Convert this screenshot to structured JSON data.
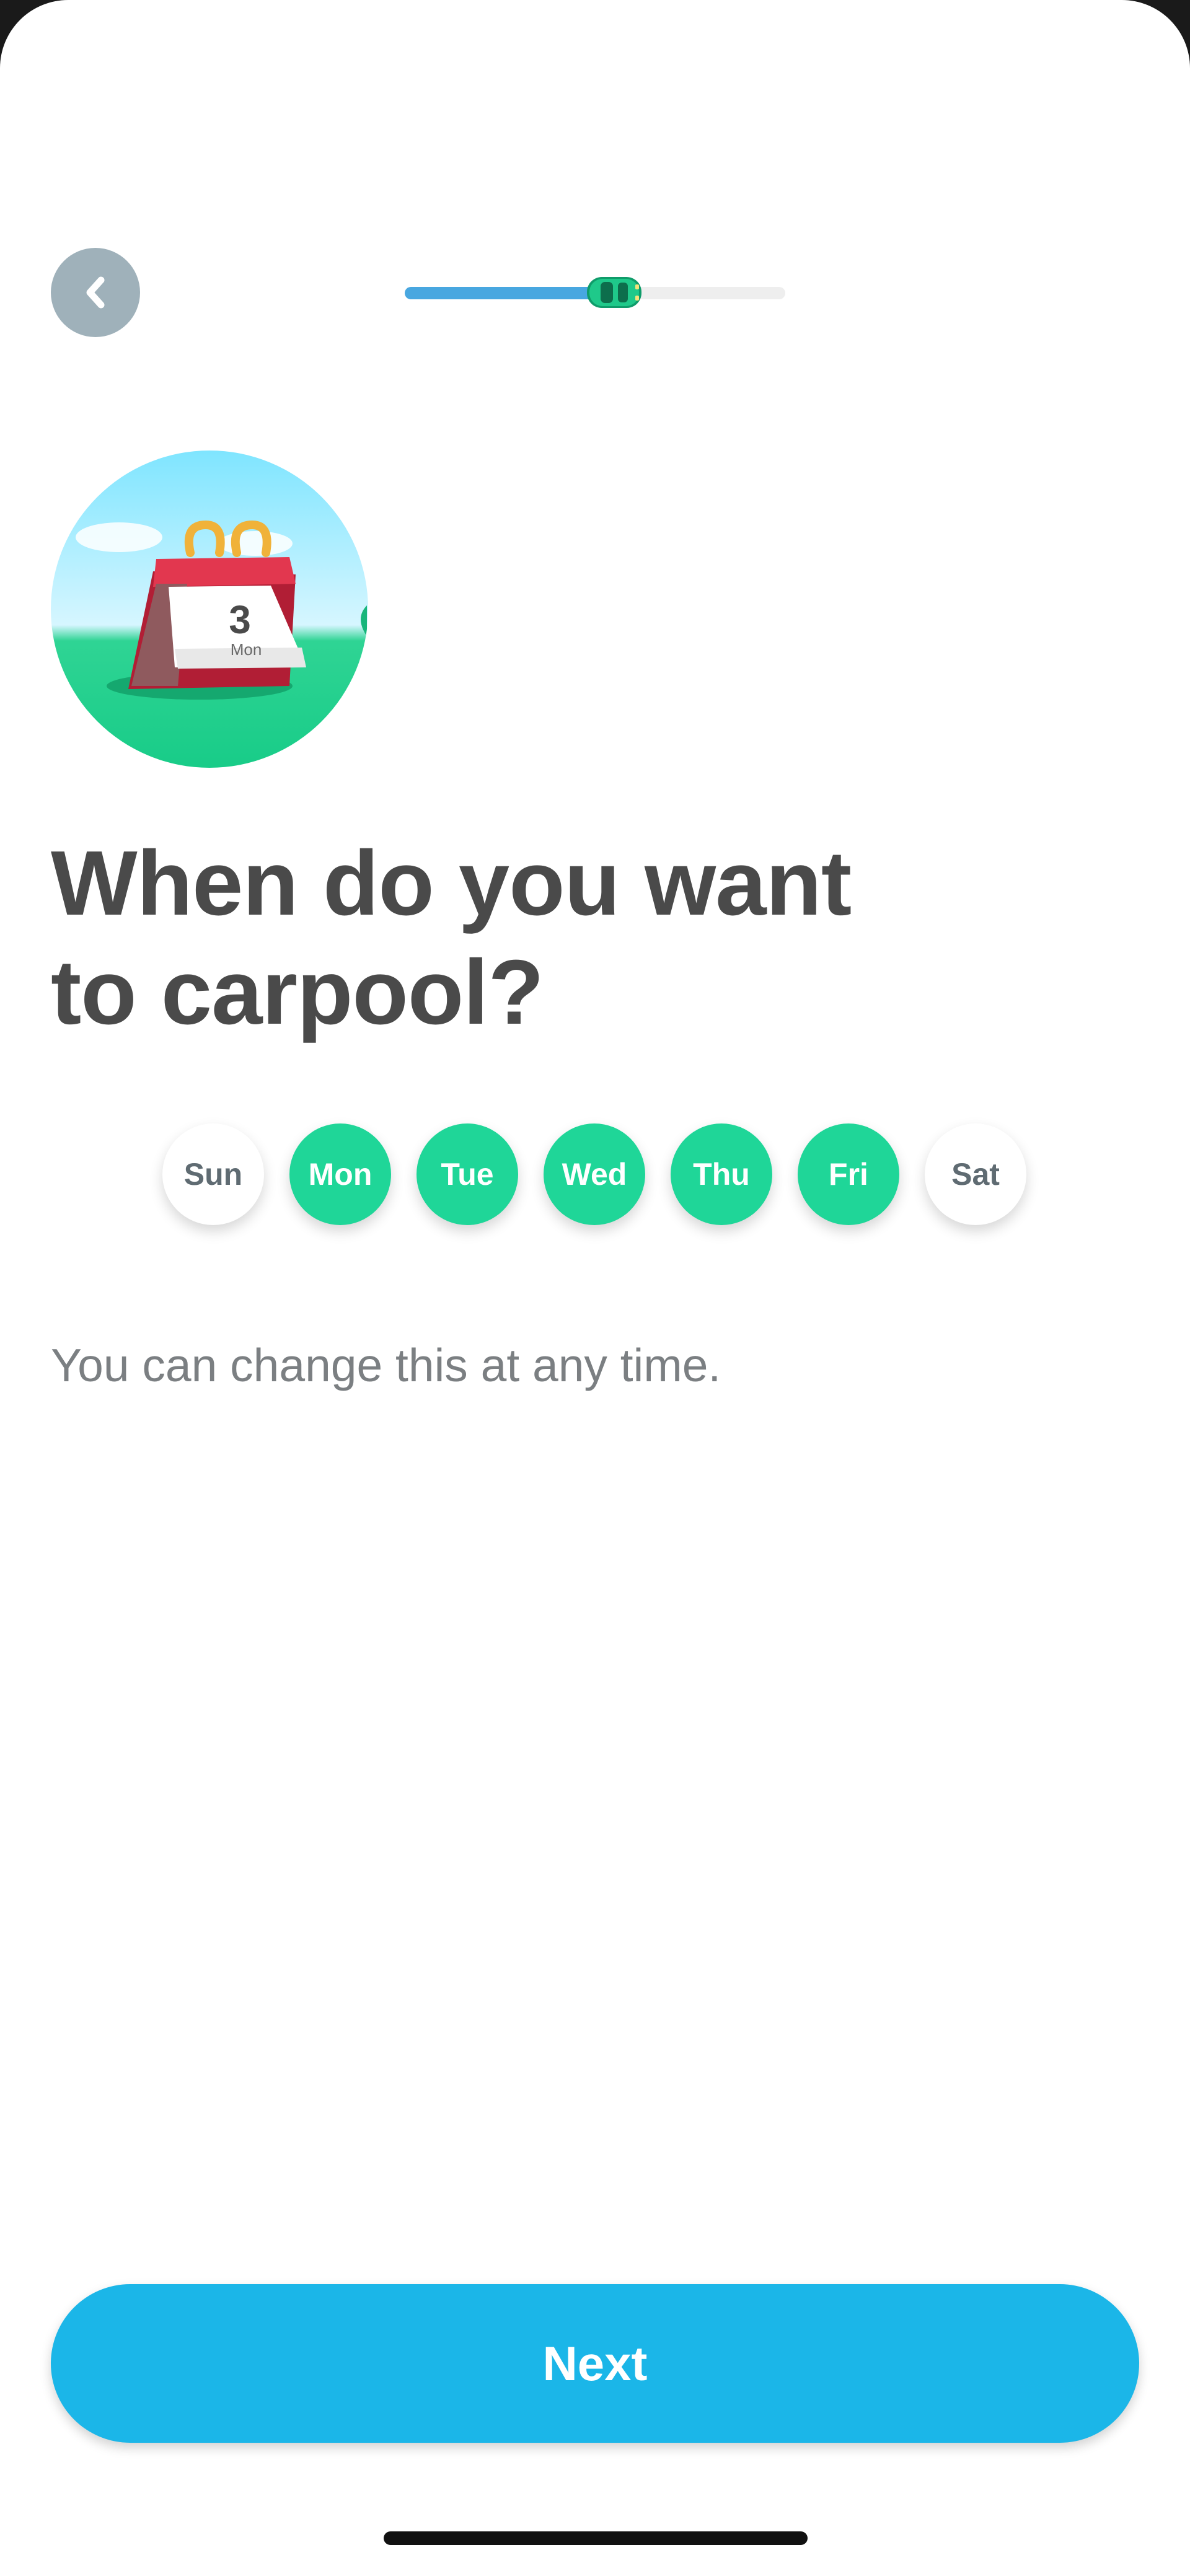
{
  "header": {
    "back_icon": "chevron-left-icon",
    "progress_fraction": 0.55,
    "progress_marker_icon": "car-icon",
    "colors": {
      "track": "#eeeeee",
      "fill": "#48a7e0",
      "car": "#1fb97e"
    }
  },
  "illustration": {
    "icon": "calendar-icon",
    "calendar_day": "3",
    "calendar_weekday": "Mon"
  },
  "title": "When do you want\nto carpool?",
  "days": [
    {
      "label": "Sun",
      "selected": false
    },
    {
      "label": "Mon",
      "selected": true
    },
    {
      "label": "Tue",
      "selected": true
    },
    {
      "label": "Wed",
      "selected": true
    },
    {
      "label": "Thu",
      "selected": true
    },
    {
      "label": "Fri",
      "selected": true
    },
    {
      "label": "Sat",
      "selected": false
    }
  ],
  "note": "You can change this at any time.",
  "footer": {
    "next_label": "Next"
  },
  "colors": {
    "accent": "#1bb6e8",
    "selected_day": "#1fd698",
    "title": "#4a4a4a"
  }
}
